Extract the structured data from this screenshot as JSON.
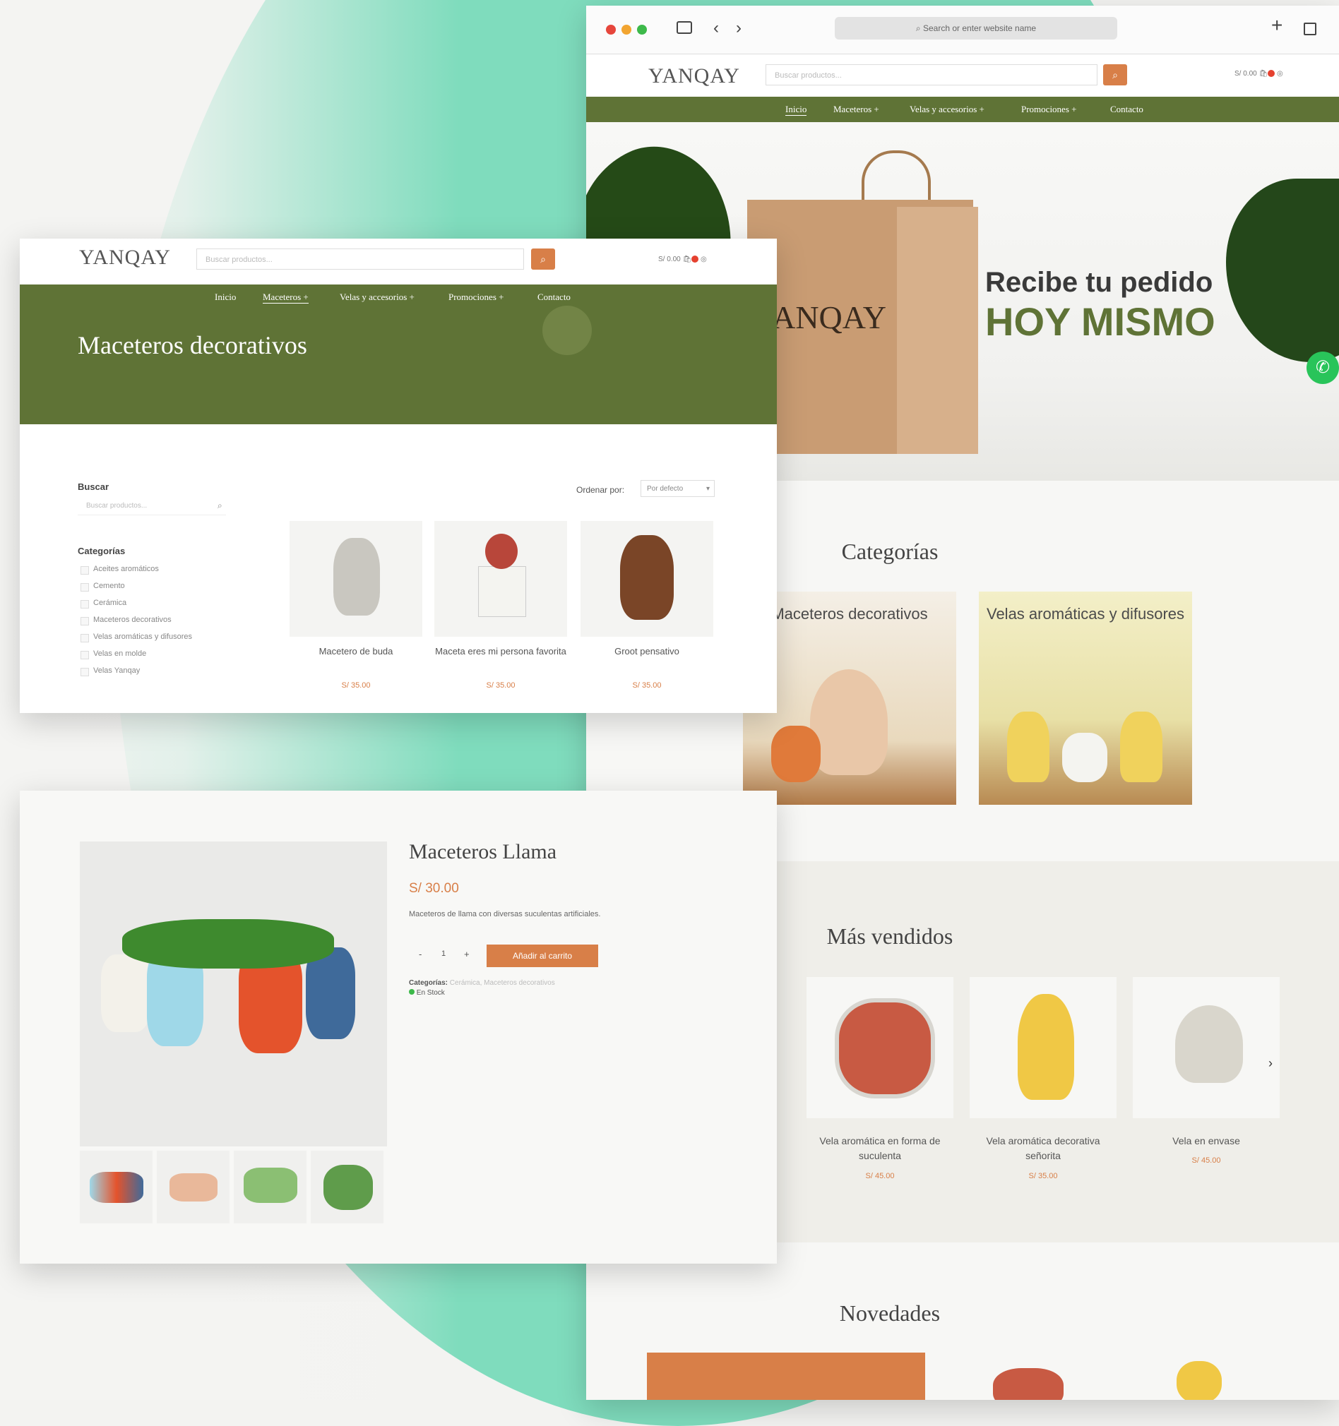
{
  "colors": {
    "mint": "#7fdcbd",
    "olive": "#5f7336",
    "accent": "#d87f48",
    "whatsapp": "#29c45a"
  },
  "browser": {
    "address_placeholder": "Search or enter website name",
    "new_tab_icon": "plus-icon",
    "tabs_icon": "tabs-icon"
  },
  "home": {
    "logo": "YANQAY",
    "search_placeholder": "Buscar productos...",
    "cart_total": "S/ 0.00",
    "nav": [
      "Inicio",
      "Maceteros +",
      "Velas y accesorios +",
      "Promociones +",
      "Contacto"
    ],
    "hero_line1": "Recibe tu pedido",
    "hero_line2": "HOY MISMO",
    "hero_bag_logo": "YANQAY",
    "categories_title": "Categorías",
    "categories": [
      "Maceteros decorativos",
      "Velas aromáticas y difusores"
    ],
    "best_sellers_title": "Más vendidos",
    "best_sellers": [
      {
        "name": "Vela aromática en forma de suculenta",
        "price": "S/ 45.00"
      },
      {
        "name": "Vela aromática decorativa señorita",
        "price": "S/ 35.00"
      },
      {
        "name": "Vela en envase",
        "price": "S/ 45.00"
      }
    ],
    "new_title": "Novedades"
  },
  "shop": {
    "logo": "YANQAY",
    "search_placeholder": "Buscar productos...",
    "cart_total": "S/ 0.00",
    "nav": [
      "Inicio",
      "Maceteros +",
      "Velas y accesorios +",
      "Promociones +",
      "Contacto"
    ],
    "page_title": "Maceteros decorativos",
    "search_label": "Buscar",
    "search_placeholder_side": "Buscar productos...",
    "categories_label": "Categorías",
    "categories": [
      "Aceites aromáticos",
      "Cemento",
      "Cerámica",
      "Maceteros decorativos",
      "Velas aromáticas y difusores",
      "Velas en molde",
      "Velas Yanqay"
    ],
    "sort_label": "Ordenar por:",
    "sort_value": "Por defecto",
    "products": [
      {
        "name": "Macetero de buda",
        "price": "S/ 35.00"
      },
      {
        "name": "Maceta eres mi persona favorita",
        "price": "S/ 35.00"
      },
      {
        "name": "Groot pensativo",
        "price": "S/ 35.00"
      }
    ]
  },
  "product": {
    "title": "Maceteros Llama",
    "price": "S/ 30.00",
    "description": "Maceteros de llama con diversas suculentas artificiales.",
    "qty_minus": "-",
    "qty_value": "1",
    "qty_plus": "+",
    "add_to_cart": "Añadir al carrito",
    "categories_label": "Categorías:",
    "categories_value": "Cerámica, Maceteros decorativos",
    "stock": "En Stock"
  }
}
